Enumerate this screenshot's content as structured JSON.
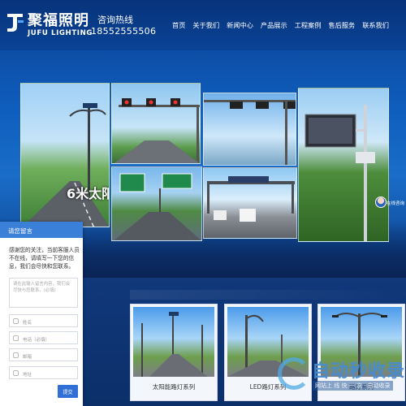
{
  "header": {
    "brand_cn": "聚福照明",
    "brand_en": "JUFU LIGHTING",
    "hotline_label": "咨询热线",
    "hotline_number": "18552555506",
    "nav": [
      "首页",
      "关于我们",
      "新闻中心",
      "产品展示",
      "工程案例",
      "售后服务",
      "联系我们"
    ]
  },
  "hero": {
    "panel_label": "6米太阳"
  },
  "products": [
    {
      "caption": "太阳能路灯系列"
    },
    {
      "caption": "LED路灯系列"
    },
    {
      "caption": "路灯系列"
    }
  ],
  "message_form": {
    "title": "请您留言",
    "intro": "感谢您的关注，当前客服人员不在线，请填写一下您的信息，我们会尽快和您联系。",
    "content_placeholder": "请在此输入留言内容，我们会尽快与您联系。(必填)",
    "fields": [
      "姓名",
      "电话（必填）",
      "邮箱",
      "地址"
    ],
    "submit": "提交"
  },
  "online_service": {
    "label": "在线咨询"
  },
  "watermark": {
    "title": "自动秒收录",
    "slogan": "网站上 线 快 一 次 · 自动收录"
  },
  "colors": {
    "header_bg": "#07337a",
    "form_header": "#3a7fd8",
    "submit_button": "#2f6fd6"
  }
}
